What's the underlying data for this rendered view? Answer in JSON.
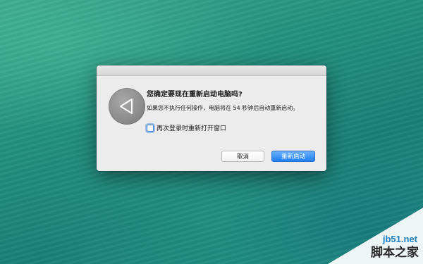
{
  "dialog": {
    "title": "您确定要现在重新启动电脑吗?",
    "message": "如果您不执行任何操作，电脑将在 54 秒钟后自动重新启动。",
    "checkbox_label": "再次登录时重新打开窗口",
    "checkbox_checked": false,
    "icon": "restart-arrow-icon",
    "cancel_label": "取消",
    "restart_label": "重新启动"
  },
  "watermark": {
    "site": "jb51.net",
    "name": "脚本之家"
  },
  "colors": {
    "primary_button": "#1f7ff0",
    "wallpaper": "#23917f"
  }
}
